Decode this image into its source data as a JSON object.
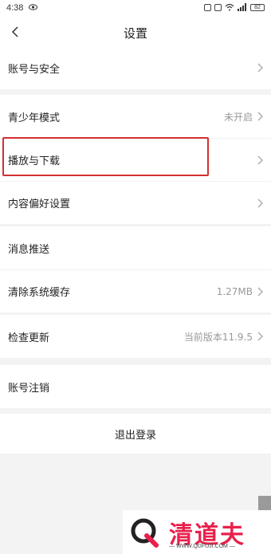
{
  "status": {
    "time": "4:38",
    "battery": "82"
  },
  "header": {
    "title": "设置"
  },
  "groups": {
    "account": {
      "label": "账号与安全"
    },
    "youth": {
      "label": "青少年模式",
      "value": "未开启"
    },
    "playback": {
      "label": "播放与下载"
    },
    "content": {
      "label": "内容偏好设置"
    },
    "push": {
      "label": "消息推送"
    },
    "cache": {
      "label": "清除系统缓存",
      "value": "1.27MB"
    },
    "update": {
      "label": "检查更新",
      "value": "当前版本11.9.5"
    },
    "cancel": {
      "label": "账号注销"
    },
    "logout": {
      "label": "退出登录"
    }
  },
  "watermark": {
    "brand": "清道夫",
    "url": "— WWW.QDFUJI.COM —"
  },
  "colors": {
    "highlight": "#d32f2f",
    "watermark": "#e8214c"
  }
}
